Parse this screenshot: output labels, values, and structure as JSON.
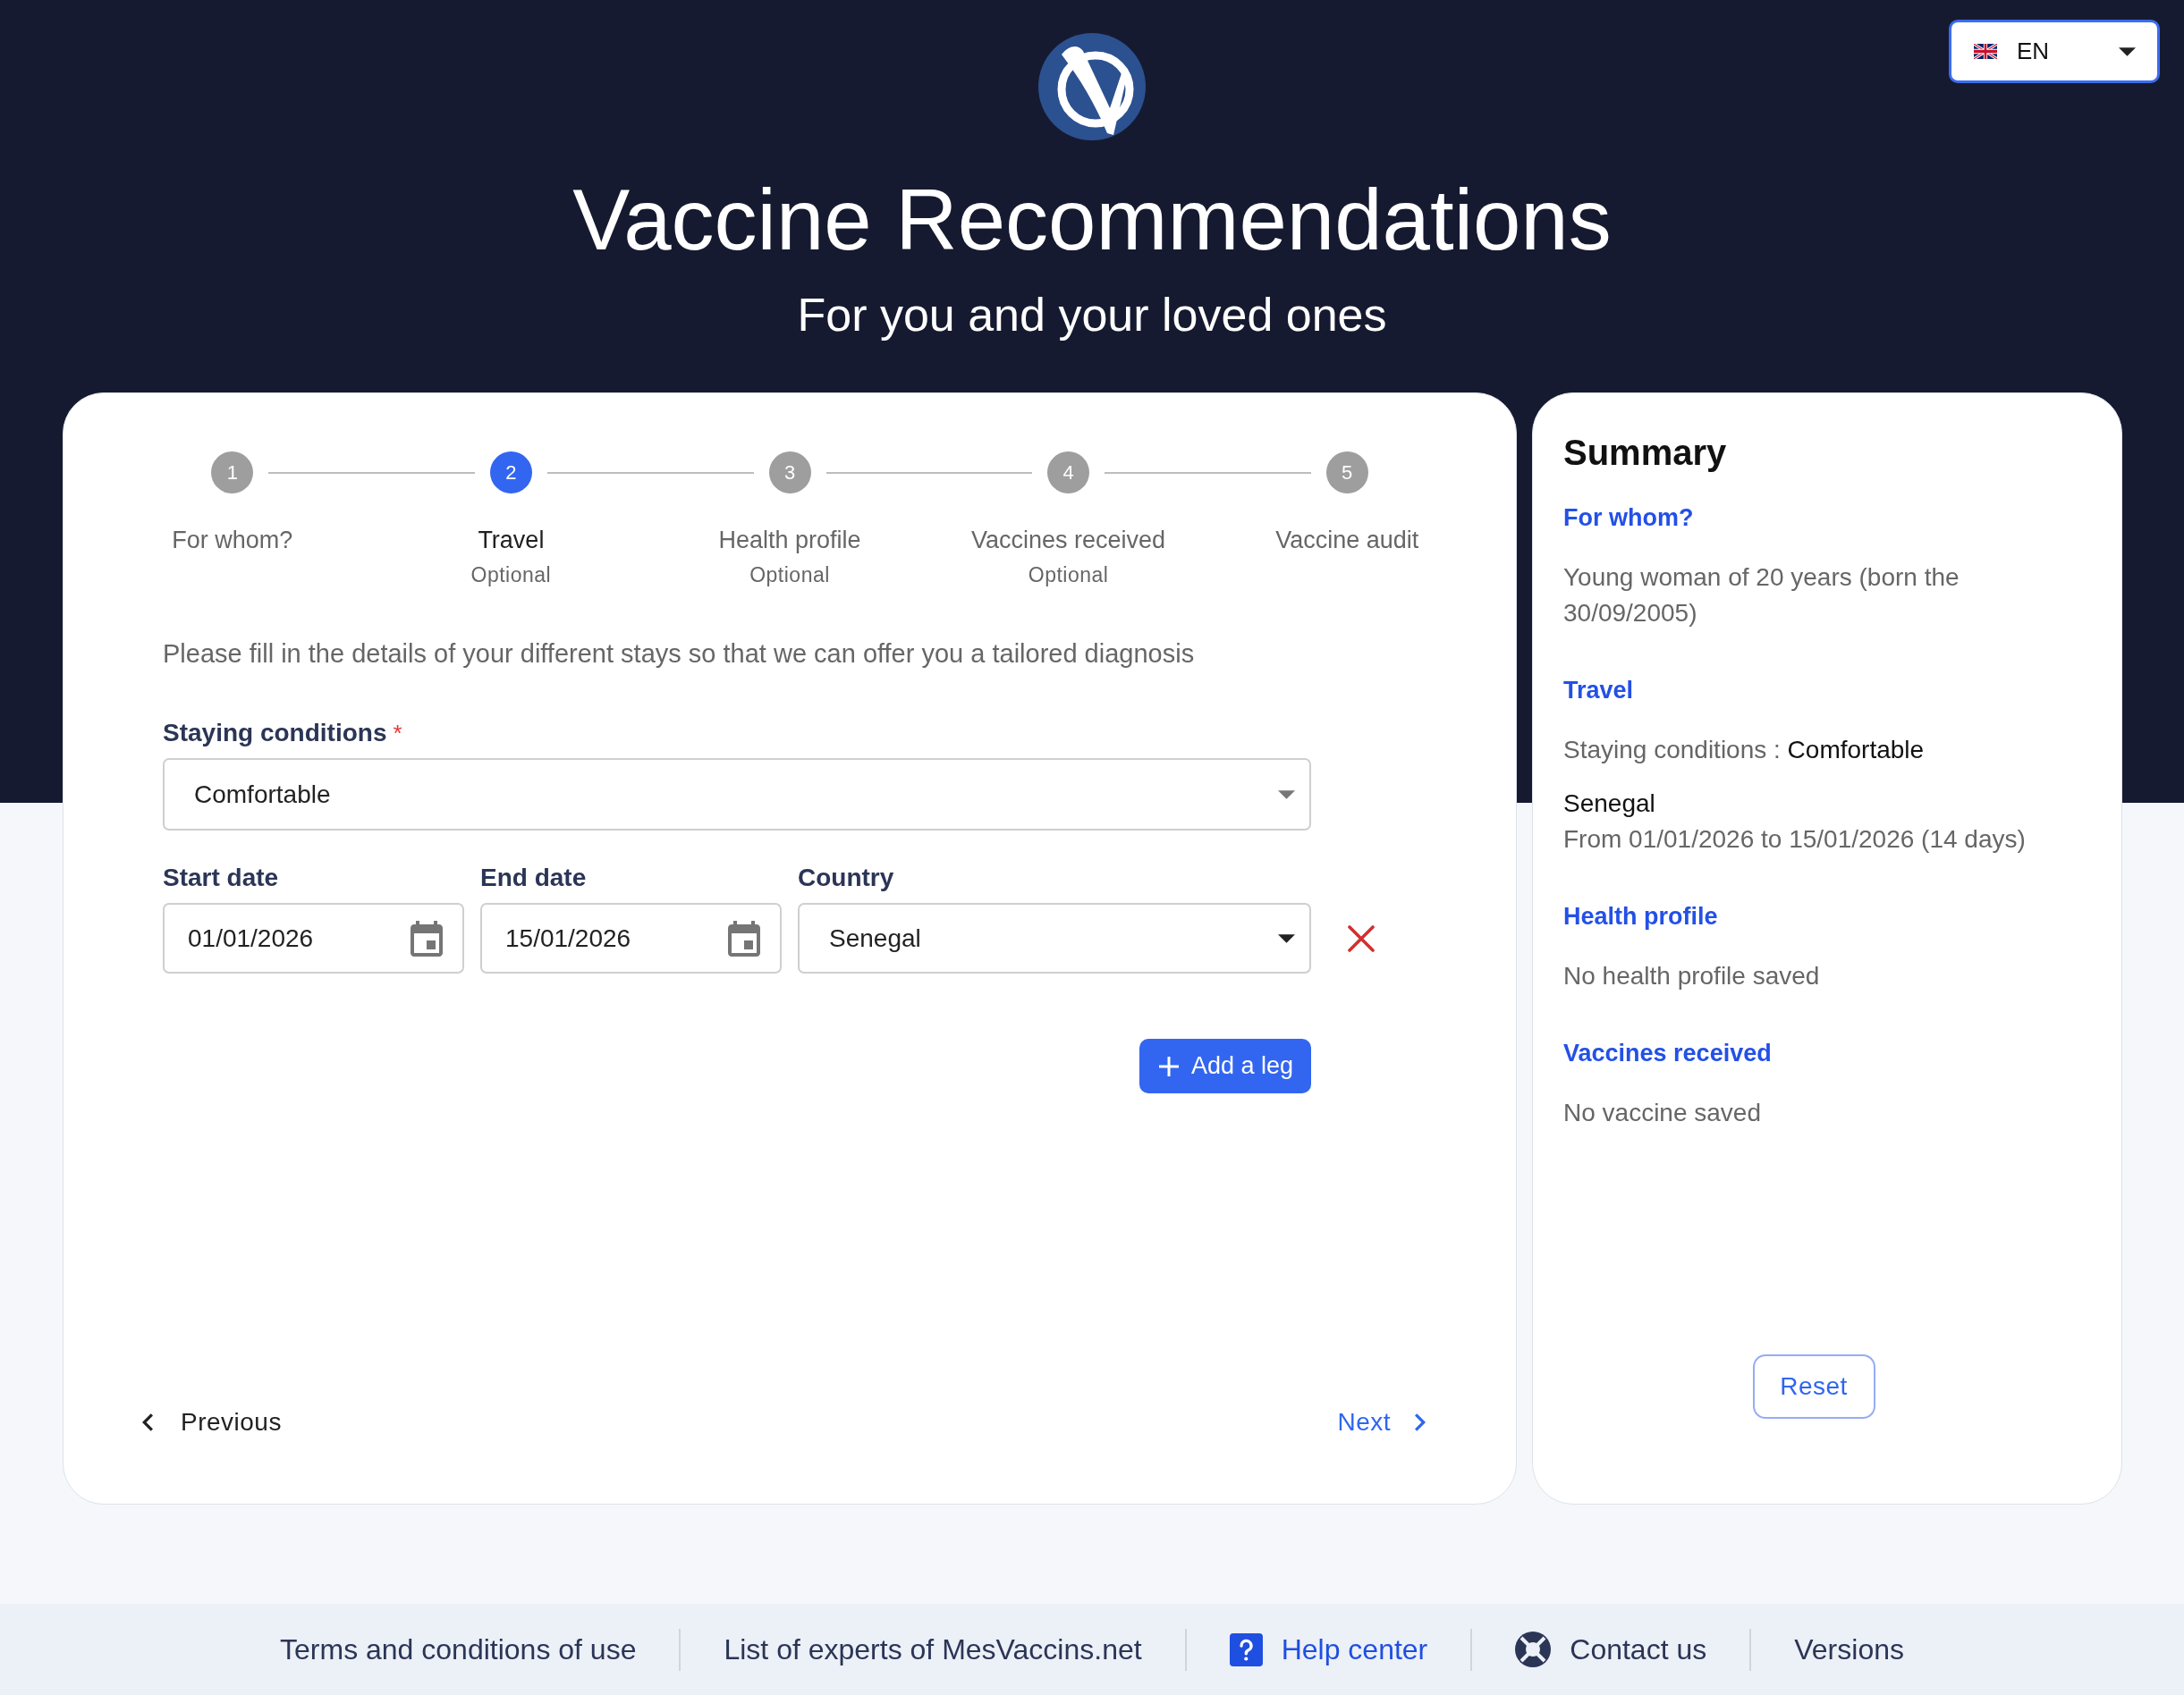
{
  "header": {
    "language": {
      "code": "EN"
    },
    "title": "Vaccine Recommendations",
    "subtitle": "For you and your loved ones"
  },
  "stepper": {
    "steps": [
      {
        "number": "1",
        "label": "For whom?",
        "selected": false
      },
      {
        "number": "2",
        "label": "Travel",
        "note": "Optional",
        "selected": true
      },
      {
        "number": "3",
        "label": "Health profile",
        "note": "Optional",
        "selected": false
      },
      {
        "number": "4",
        "label": "Vaccines received",
        "note": "Optional",
        "selected": false
      },
      {
        "number": "5",
        "label": "Vaccine audit",
        "selected": false
      }
    ]
  },
  "travel_form": {
    "intro": "Please fill in the details of your different stays so that we can offer you a tailored diagnosis",
    "staying_conditions": {
      "label": "Staying conditions",
      "required_mark": "*",
      "value": "Comfortable"
    },
    "legs": [
      {
        "start_date": {
          "label": "Start date",
          "value": "01/01/2026"
        },
        "end_date": {
          "label": "End date",
          "value": "15/01/2026"
        },
        "country": {
          "label": "Country",
          "value": "Senegal"
        }
      }
    ],
    "add_leg_button": "Add a leg"
  },
  "navigation": {
    "previous": "Previous",
    "next": "Next"
  },
  "summary": {
    "title": "Summary",
    "sections": [
      {
        "kind": "text",
        "heading": "For whom?",
        "text": "Young woman of 20 years (born the 30/09/2005)"
      },
      {
        "kind": "travel",
        "heading": "Travel",
        "conditions": {
          "label": "Staying conditions :",
          "value": "Comfortable"
        },
        "stays": [
          {
            "country": "Senegal",
            "period": "From 01/01/2026 to 15/01/2026 (14 days)"
          }
        ]
      },
      {
        "kind": "text",
        "heading": "Health profile",
        "text": "No health profile saved"
      },
      {
        "kind": "text",
        "heading": "Vaccines received",
        "text": "No vaccine saved"
      }
    ],
    "reset_button": "Reset"
  },
  "footer": {
    "links": [
      {
        "kind": "plain",
        "label": "Terms and conditions of use"
      },
      {
        "kind": "plain",
        "label": "List of experts of MesVaccins.net"
      },
      {
        "kind": "help",
        "label": "Help center"
      },
      {
        "kind": "contact",
        "label": "Contact us"
      },
      {
        "kind": "plain",
        "label": "Versions"
      }
    ]
  }
}
